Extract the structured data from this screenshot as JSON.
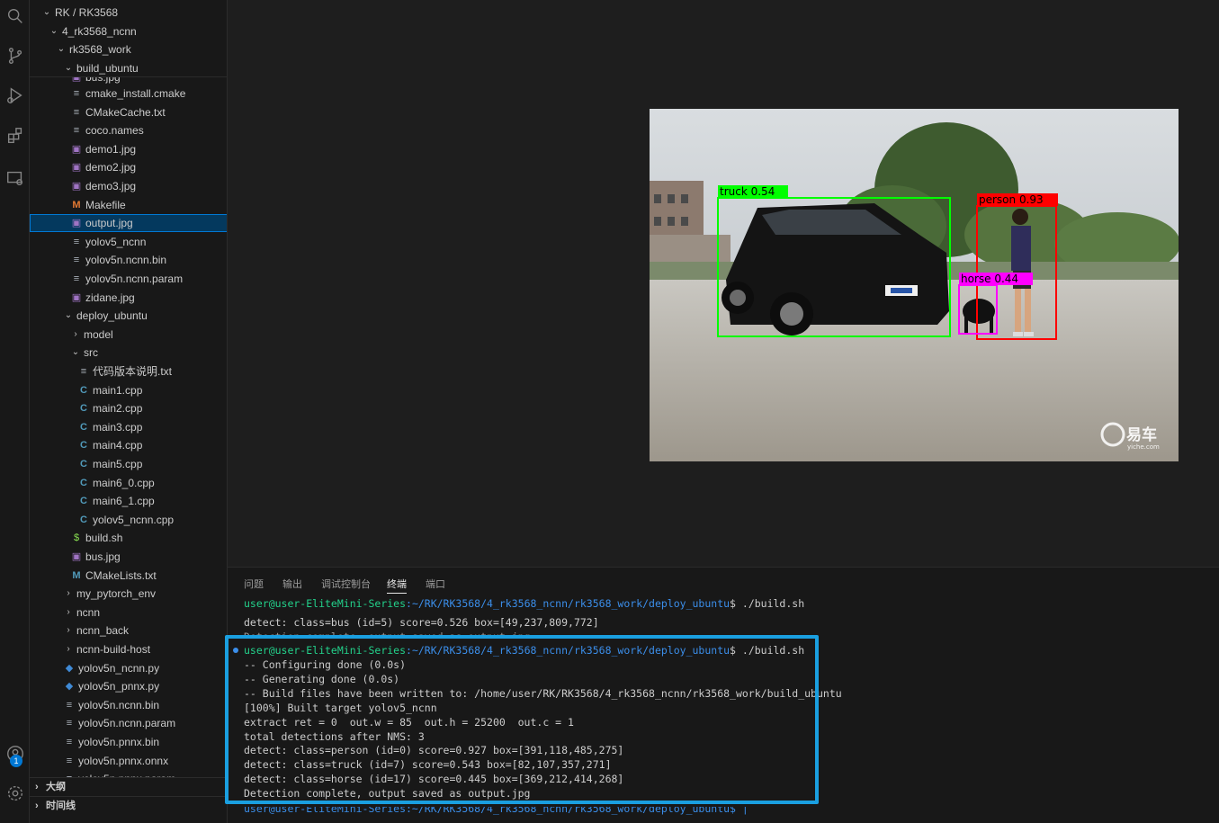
{
  "explorer": {
    "sticky": [
      {
        "label": "RK / RK3568",
        "depth": 0
      },
      {
        "label": "4_rk3568_ncnn",
        "depth": 1
      },
      {
        "label": "rk3568_work",
        "depth": 2
      },
      {
        "label": "build_ubuntu",
        "depth": 3
      }
    ],
    "partial_top": "bus.jpg",
    "items": [
      {
        "label": "cmake_install.cmake",
        "kind": "txt",
        "depth": 4
      },
      {
        "label": "CMakeCache.txt",
        "kind": "txt",
        "depth": 4
      },
      {
        "label": "coco.names",
        "kind": "txt",
        "depth": 4
      },
      {
        "label": "demo1.jpg",
        "kind": "img",
        "depth": 4
      },
      {
        "label": "demo2.jpg",
        "kind": "img",
        "depth": 4
      },
      {
        "label": "demo3.jpg",
        "kind": "img",
        "depth": 4
      },
      {
        "label": "Makefile",
        "kind": "mk",
        "depth": 4
      },
      {
        "label": "output.jpg",
        "kind": "img",
        "depth": 4,
        "selected": true
      },
      {
        "label": "yolov5_ncnn",
        "kind": "txt",
        "depth": 4
      },
      {
        "label": "yolov5n.ncnn.bin",
        "kind": "txt",
        "depth": 4
      },
      {
        "label": "yolov5n.ncnn.param",
        "kind": "txt",
        "depth": 4
      },
      {
        "label": "zidane.jpg",
        "kind": "img",
        "depth": 4
      },
      {
        "label": "deploy_ubuntu",
        "kind": "folder-open",
        "depth": 3
      },
      {
        "label": "model",
        "kind": "folder",
        "depth": 4
      },
      {
        "label": "src",
        "kind": "folder-open",
        "depth": 4
      },
      {
        "label": "代码版本说明.txt",
        "kind": "txt",
        "depth": 5
      },
      {
        "label": "main1.cpp",
        "kind": "cpp",
        "depth": 5
      },
      {
        "label": "main2.cpp",
        "kind": "cpp",
        "depth": 5
      },
      {
        "label": "main3.cpp",
        "kind": "cpp",
        "depth": 5
      },
      {
        "label": "main4.cpp",
        "kind": "cpp",
        "depth": 5
      },
      {
        "label": "main5.cpp",
        "kind": "cpp",
        "depth": 5
      },
      {
        "label": "main6_0.cpp",
        "kind": "cpp",
        "depth": 5
      },
      {
        "label": "main6_1.cpp",
        "kind": "cpp",
        "depth": 5
      },
      {
        "label": "yolov5_ncnn.cpp",
        "kind": "cpp",
        "depth": 5
      },
      {
        "label": "build.sh",
        "kind": "sh",
        "depth": 4
      },
      {
        "label": "bus.jpg",
        "kind": "img",
        "depth": 4
      },
      {
        "label": "CMakeLists.txt",
        "kind": "cm",
        "depth": 4
      },
      {
        "label": "my_pytorch_env",
        "kind": "folder",
        "depth": 3
      },
      {
        "label": "ncnn",
        "kind": "folder",
        "depth": 3
      },
      {
        "label": "ncnn_back",
        "kind": "folder",
        "depth": 3
      },
      {
        "label": "ncnn-build-host",
        "kind": "folder",
        "depth": 3
      },
      {
        "label": "yolov5n_ncnn.py",
        "kind": "py",
        "depth": 3
      },
      {
        "label": "yolov5n_pnnx.py",
        "kind": "py",
        "depth": 3
      },
      {
        "label": "yolov5n.ncnn.bin",
        "kind": "txt",
        "depth": 3
      },
      {
        "label": "yolov5n.ncnn.param",
        "kind": "txt",
        "depth": 3
      },
      {
        "label": "yolov5n.pnnx.bin",
        "kind": "txt",
        "depth": 3
      },
      {
        "label": "yolov5n.pnnx.onnx",
        "kind": "txt",
        "depth": 3
      }
    ],
    "partial_bottom": "yolov5n.pnnx.param",
    "outline_label": "大纲",
    "timeline_label": "时间线"
  },
  "activity": {
    "icons": [
      "search-icon",
      "source-control-icon",
      "run-debug-icon",
      "extensions-icon",
      "remote-explorer-icon"
    ],
    "account_badge": "1"
  },
  "image": {
    "detections": [
      {
        "label": "truck 0.54",
        "color": "#00ff00"
      },
      {
        "label": "person 0.93",
        "color": "#ff0000"
      },
      {
        "label": "horse 0.44",
        "color": "#ff00ff"
      }
    ],
    "watermark": "易车",
    "watermark_sub": "yiche.com"
  },
  "panel": {
    "tabs": [
      "问题",
      "输出",
      "调试控制台",
      "终端",
      "端口"
    ],
    "active_tab": "终端",
    "prev_prompt_user": "user@user-EliteMini-Series",
    "prev_prompt_path": ":~/RK/RK3568/4_rk3568_ncnn/rk3568_work/deploy_ubuntu",
    "prev_prompt_cmd": "$ ./build.sh",
    "prev_line1": "detect: class=bus (id=5) score=0.526 box=[49,237,809,772]",
    "prev_line2": "Detection complete, output saved as output.jpg",
    "prompt_user": "user@user-EliteMini-Series",
    "prompt_path": ":~/RK/RK3568/4_rk3568_ncnn/rk3568_work/deploy_ubuntu",
    "prompt_cmd": "$ ./build.sh",
    "lines": [
      "-- Configuring done (0.0s)",
      "-- Generating done (0.0s)",
      "-- Build files have been written to: /home/user/RK/RK3568/4_rk3568_ncnn/rk3568_work/build_ubuntu",
      "[100%] Built target yolov5_ncnn",
      "extract ret = 0  out.w = 85  out.h = 25200  out.c = 1",
      "total detections after NMS: 3",
      "detect: class=person (id=0) score=0.927 box=[391,118,485,275]",
      "detect: class=truck (id=7) score=0.543 box=[82,107,357,271]",
      "detect: class=horse (id=17) score=0.445 box=[369,212,414,268]",
      "Detection complete, output saved as output.jpg"
    ],
    "next_prompt": "user@user-EliteMini-Series:~/RK/RK3568/4_rk3568_ncnn/rk3568_work/deploy_ubuntu$ |"
  }
}
